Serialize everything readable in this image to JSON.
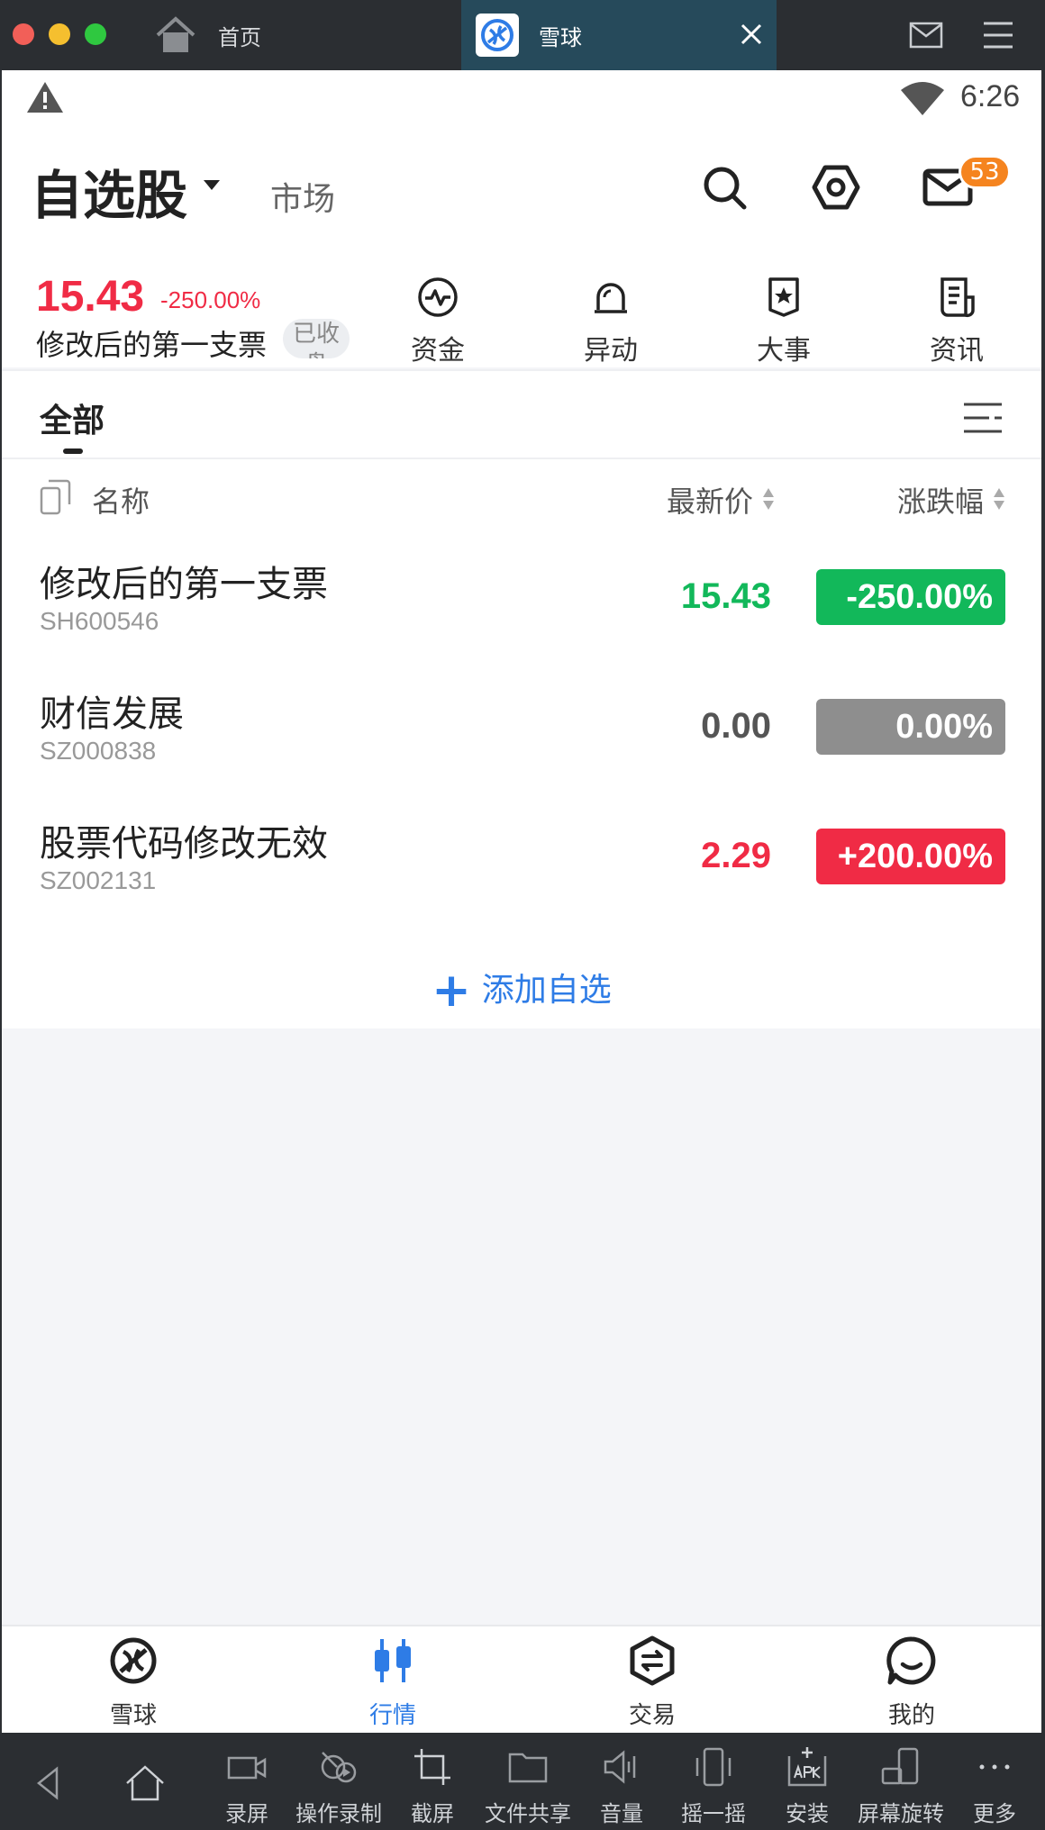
{
  "emulator": {
    "tabs": [
      {
        "label": "首页"
      },
      {
        "label": "雪球"
      }
    ],
    "toolbar": [
      {
        "label": "",
        "icon": "back-icon"
      },
      {
        "label": "",
        "icon": "home-icon"
      },
      {
        "label": "录屏",
        "icon": "video-camera-icon"
      },
      {
        "label": "操作录制",
        "icon": "record-operation-icon"
      },
      {
        "label": "截屏",
        "icon": "crop-icon"
      },
      {
        "label": "文件共享",
        "icon": "folder-icon"
      },
      {
        "label": "音量",
        "icon": "volume-icon"
      },
      {
        "label": "摇一摇",
        "icon": "shake-phone-icon"
      },
      {
        "label": "安装",
        "icon": "apk-install-icon"
      },
      {
        "label": "屏幕旋转",
        "icon": "rotate-screen-icon"
      },
      {
        "label": "更多",
        "icon": "more-dots-icon"
      }
    ]
  },
  "status": {
    "time": "6:26"
  },
  "header": {
    "title": "自选股",
    "market": "市场",
    "mail_badge": "53"
  },
  "quick": {
    "price": "15.43",
    "change": "-250.00%",
    "name": "修改后的第一支票",
    "status": "已收盘",
    "items": [
      {
        "label": "资金",
        "icon": "funds-pulse-icon"
      },
      {
        "label": "异动",
        "icon": "alarm-bell-icon"
      },
      {
        "label": "大事",
        "icon": "star-shield-icon"
      },
      {
        "label": "资讯",
        "icon": "news-doc-icon"
      }
    ]
  },
  "tabs": {
    "active": "全部"
  },
  "list": {
    "headers": {
      "name": "名称",
      "price": "最新价",
      "change": "涨跌幅"
    },
    "rows": [
      {
        "name": "修改后的第一支票",
        "code": "SH600546",
        "price": "15.43",
        "change": "-250.00%",
        "price_color": "#12b85a",
        "badge_color": "#12b85a"
      },
      {
        "name": "财信发展",
        "code": "SZ000838",
        "price": "0.00",
        "change": "0.00%",
        "price_color": "#555555",
        "badge_color": "#8e8e8e"
      },
      {
        "name": "股票代码修改无效",
        "code": "SZ002131",
        "price": "2.29",
        "change": "+200.00%",
        "price_color": "#f02b45",
        "badge_color": "#f02b45"
      }
    ],
    "add_label": "添加自选"
  },
  "bottom_nav": [
    {
      "label": "雪球",
      "icon": "xueqiu-logo-icon"
    },
    {
      "label": "行情",
      "icon": "candlestick-icon",
      "active": true
    },
    {
      "label": "交易",
      "icon": "trade-hex-icon"
    },
    {
      "label": "我的",
      "icon": "smile-chat-icon"
    }
  ],
  "colors": {
    "accent": "#2e7ce6",
    "up": "#f02b45",
    "down": "#12b85a",
    "badge": "#f5841f"
  }
}
